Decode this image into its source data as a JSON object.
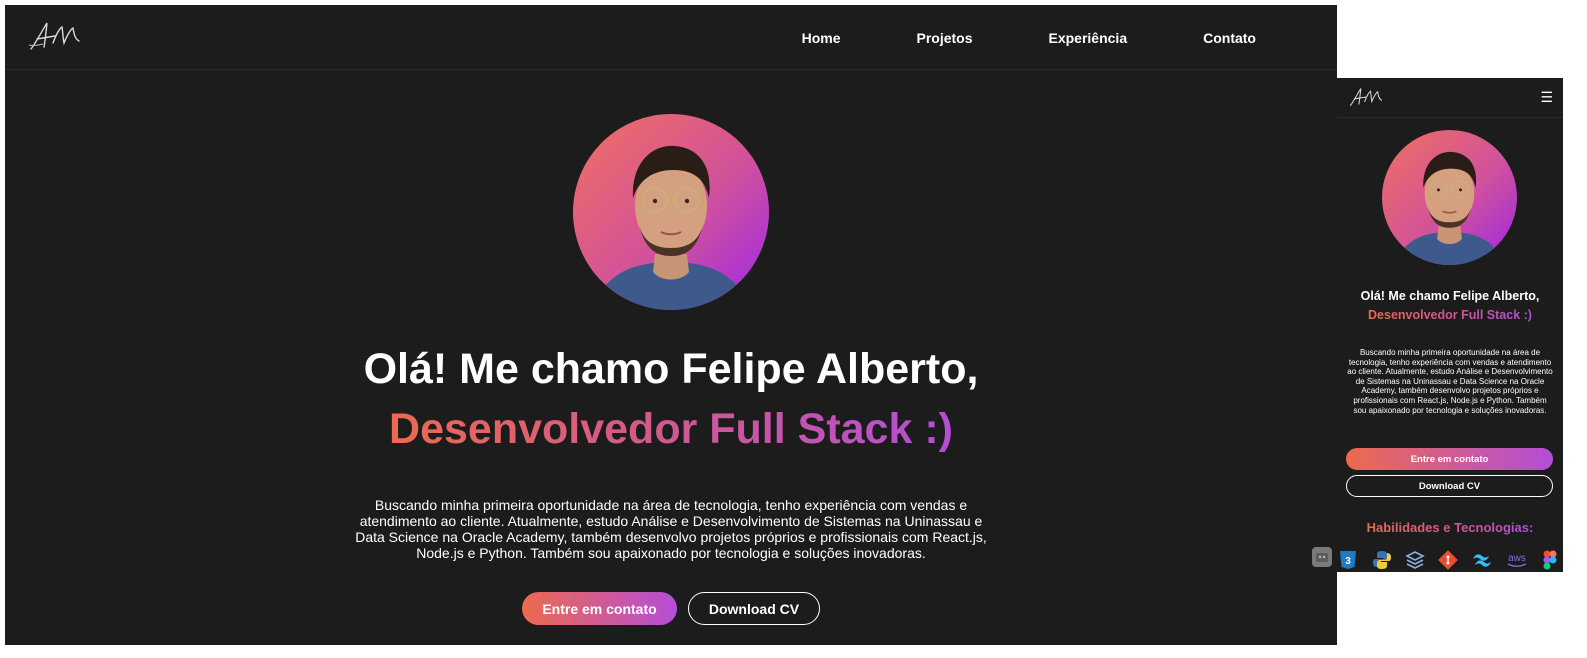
{
  "nav": {
    "items": [
      {
        "label": "Home"
      },
      {
        "label": "Projetos"
      },
      {
        "label": "Experiência"
      },
      {
        "label": "Contato"
      }
    ]
  },
  "hero": {
    "line1": "Olá! Me chamo Felipe Alberto,",
    "line2": "Desenvolvedor Full Stack :)",
    "about": "Buscando minha primeira oportunidade na área de tecnologia, tenho experiência com vendas e atendimento ao cliente. Atualmente, estudo Análise e Desenvolvimento de Sistemas na Uninassau e Data Science na Oracle Academy, também desenvolvo projetos próprios e profissionais com React.js, Node.js e Python. Também sou apaixonado por tecnologia e soluções inovadoras.",
    "contact_button": "Entre em contato",
    "cv_button": "Download CV"
  },
  "mobile": {
    "menu_icon": "☰",
    "skills_title": "Habilidades e Tecnologias:",
    "skill_icons": [
      "css3-icon",
      "python-icon",
      "stack-icon",
      "git-icon",
      "tailwind-icon",
      "aws-icon",
      "figma-icon"
    ]
  },
  "colors": {
    "background": "#1c1c1c",
    "gradient_start": "#ec6a4e",
    "gradient_end": "#b44ed8"
  }
}
